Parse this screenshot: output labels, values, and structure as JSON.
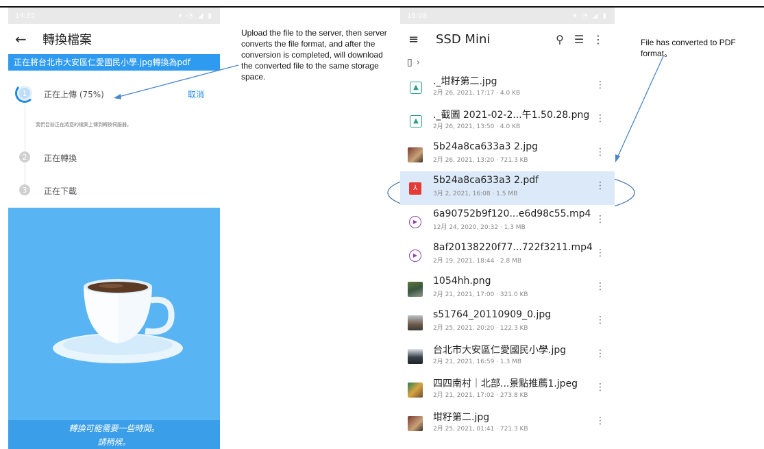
{
  "left_phone": {
    "status_time": "14:35",
    "title": "轉換檔案",
    "banner": "正在將台北市大安區仁愛國民小學.jpg轉換為pdf",
    "steps": [
      {
        "number": "1",
        "label": "正在上傳 (75%)",
        "state": "active",
        "progress": 0.75
      },
      {
        "number": "2",
        "label": "正在轉換",
        "state": "pending"
      },
      {
        "number": "3",
        "label": "正在下載",
        "state": "pending"
      }
    ],
    "cancel_label": "取消",
    "step_note": "我們目前正在將您的檔案上傳到轉換伺服器。",
    "bottom_text_1": "轉換可能需要一些時間。",
    "bottom_text_2": "請稍候。"
  },
  "annotations": {
    "left_text": "Upload the file to the server, then server converts the  file format, and after the conversion is completed,  will download the converted file to the same storage space.",
    "right_text": "File has converted to PDF format。"
  },
  "right_phone": {
    "status_time": "16:08",
    "title": "SSD Mini",
    "files": [
      {
        "name": "._坩籽第二.jpg",
        "meta": "2月 26, 2021, 17:17 · 4.0 KB",
        "icon": "image-file-icon"
      },
      {
        "name": "._截圖 2021-02-2...午1.50.28.png",
        "meta": "2月 26, 2021, 13:50 · 4.0 KB",
        "icon": "image-file-icon"
      },
      {
        "name": "5b24a8ca633a3 2.jpg",
        "meta": "2月 26, 2021, 13:20 · 721.3 KB",
        "icon": "photo-thumbnail"
      },
      {
        "name": "5b24a8ca633a3 2.pdf",
        "meta": "3月 2, 2021, 16:08 · 1.5 MB",
        "icon": "pdf-icon"
      },
      {
        "name": "6a90752b9f120...e6d98c55.mp4",
        "meta": "12月 24, 2020, 20:32 · 1.3 MB",
        "icon": "video-icon"
      },
      {
        "name": "8af20138220f77...722f3211.mp4",
        "meta": "2月 19, 2021, 18:44 · 2.8 MB",
        "icon": "video-icon"
      },
      {
        "name": "1054hh.png",
        "meta": "2月 21, 2021, 17:00 · 321.0 KB",
        "icon": "photo-thumbnail"
      },
      {
        "name": "s51764_20110909_0.jpg",
        "meta": "2月 25, 2021, 20:20 · 122.3 KB",
        "icon": "photo-thumbnail"
      },
      {
        "name": "台北市大安區仁愛國民小學.jpg",
        "meta": "2月 21, 2021, 16:59 · 1.3 MB",
        "icon": "photo-thumbnail"
      },
      {
        "name": "四四南村｜北部...景點推薦1.jpeg",
        "meta": "2月 21, 2021, 17:02 · 273.8 KB",
        "icon": "photo-thumbnail"
      },
      {
        "name": "坩籽第二.jpg",
        "meta": "2月 25, 2021, 01:41 · 721.3 KB",
        "icon": "photo-thumbnail"
      }
    ]
  },
  "colors": {
    "accent_blue": "#2f9bf0",
    "cup_background": "#59b4f3",
    "selected_row": "#dbe9f8",
    "pdf_red": "#e53935",
    "annotation_line": "#4a86c8"
  }
}
